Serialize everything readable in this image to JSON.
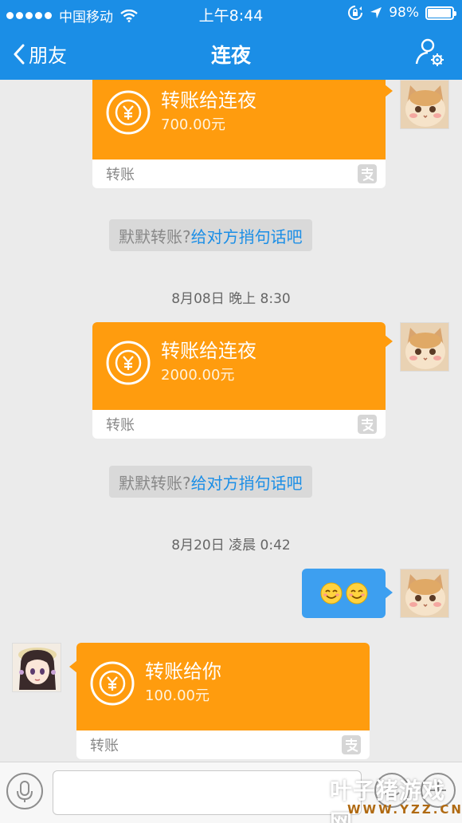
{
  "status_bar": {
    "carrier": "中国移动",
    "time": "上午8:44",
    "battery": "98%",
    "battery_level": 0.98
  },
  "nav": {
    "back_label": "朋友",
    "title": "连夜"
  },
  "messages": {
    "transfer_1": {
      "title": "转账给连夜",
      "amount": "700.00元",
      "footer": "转账"
    },
    "hint_1": {
      "prefix": "默默转账?",
      "link": "给对方捎句话吧"
    },
    "time_1": "8月08日 晚上 8:30",
    "transfer_2": {
      "title": "转账给连夜",
      "amount": "2000.00元",
      "footer": "转账"
    },
    "hint_2": {
      "prefix": "默默转账?",
      "link": "给对方捎句话吧"
    },
    "time_2": "8月20日 凌晨 0:42",
    "emoji_message": "😊😊",
    "transfer_3": {
      "title": "转账给你",
      "amount": "100.00元",
      "footer": "转账"
    }
  },
  "input_bar": {
    "placeholder": ""
  },
  "watermark": {
    "main": "叶子猪游戏网",
    "sub": "WWW.YZZ.CN"
  },
  "colors": {
    "nav_blue": "#1b8ee6",
    "transfer_orange": "#ff9c0e",
    "emoji_bubble_blue": "#3d9ff0",
    "link_blue": "#1b8ee6"
  }
}
